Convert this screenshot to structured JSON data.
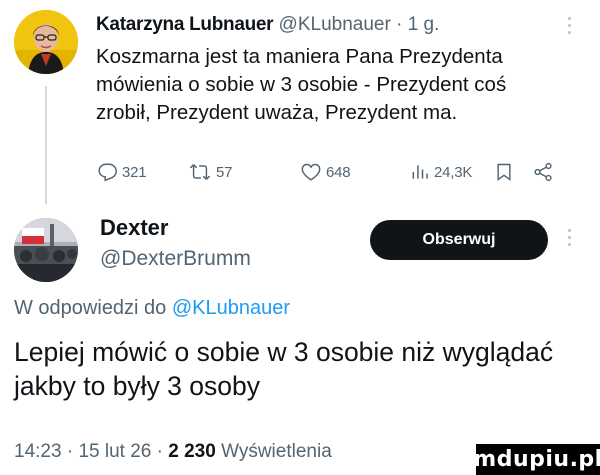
{
  "tweet1": {
    "author_name": "Katarzyna Lubnauer",
    "author_handle": "@KLubnauer",
    "separator": "·",
    "time": "1 g.",
    "text": "Koszmarna jest ta maniera Pana Prezydenta mówienia o sobie w 3 osobie - Prezydent coś zrobił, Prezydent uważa, Prezydent ma.",
    "actions": {
      "replies": "321",
      "reposts": "57",
      "likes": "648",
      "views": "24,3K"
    }
  },
  "tweet2": {
    "author_name": "Dexter",
    "author_handle": "@DexterBrumm",
    "follow_label": "Obserwuj",
    "reply_prefix": "W odpowiedzi do",
    "reply_mention": "@KLubnauer",
    "text": "Lepiej mówić o sobie w 3 osobie niż wyglądać jakby to były 3 osoby",
    "meta": {
      "time": "14:23",
      "sep1": "·",
      "date": "15 lut 26",
      "sep2": "·",
      "views_count": "2 230",
      "views_label": "Wyświetlenia"
    }
  },
  "watermark": "mdupiu.pl",
  "icons": [
    "reply-icon",
    "repost-icon",
    "like-icon",
    "views-icon",
    "bookmark-icon",
    "share-icon",
    "more-icon"
  ],
  "colors": {
    "link": "#1d9bf0",
    "muted": "#536471",
    "button": "#0f1419"
  }
}
